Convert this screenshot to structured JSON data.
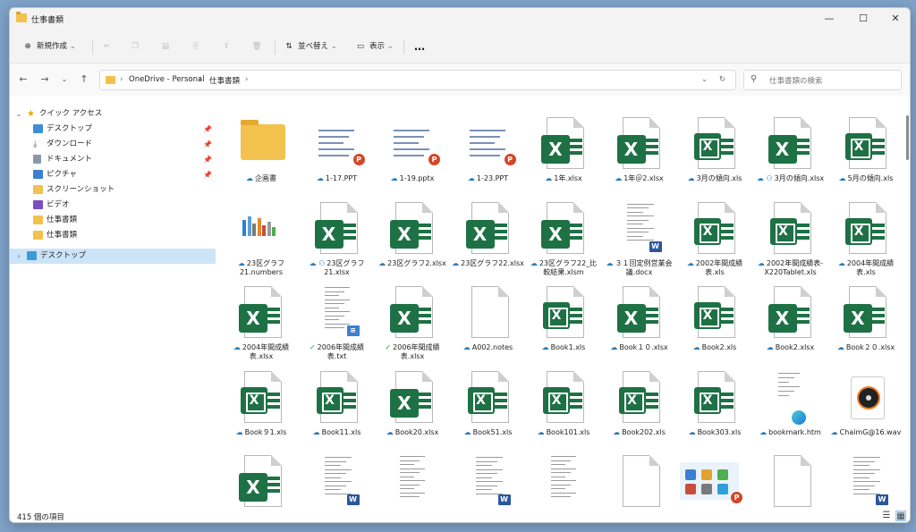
{
  "window": {
    "title": "仕事書類",
    "minimize": "—",
    "maximize": "☐",
    "close": "✕"
  },
  "commandbar": {
    "new_label": "新規作成",
    "sort_label": "並べ替え",
    "view_label": "表示",
    "more": "…"
  },
  "nav": {
    "breadcrumb": [
      "OneDrive - Personal",
      "仕事書類"
    ],
    "search_placeholder": "仕事書類の検索"
  },
  "sidebar": {
    "quick_access": "クイック アクセス",
    "items": [
      {
        "label": "デスクトップ",
        "pinned": true,
        "icon": "desktop-icon"
      },
      {
        "label": "ダウンロード",
        "pinned": true,
        "icon": "download-icon"
      },
      {
        "label": "ドキュメント",
        "pinned": true,
        "icon": "document-icon"
      },
      {
        "label": "ピクチャ",
        "pinned": true,
        "icon": "picture-icon"
      },
      {
        "label": "スクリーンショット",
        "pinned": false,
        "icon": "folder-icon"
      },
      {
        "label": "ビデオ",
        "pinned": false,
        "icon": "video-icon"
      },
      {
        "label": "仕事書類",
        "pinned": false,
        "icon": "folder-icon"
      },
      {
        "label": "仕事書類",
        "pinned": false,
        "icon": "folder-icon"
      }
    ],
    "desktop_root": "デスクトップ"
  },
  "files": [
    {
      "name": "企画書",
      "type": "folder",
      "status": "cloud"
    },
    {
      "name": "1-17.PPT",
      "type": "ppt",
      "status": "cloud"
    },
    {
      "name": "1-19.pptx",
      "type": "ppt",
      "status": "cloud"
    },
    {
      "name": "1-23.PPT",
      "type": "ppt",
      "status": "cloud"
    },
    {
      "name": "1年.xlsx",
      "type": "xlsx",
      "status": "cloud"
    },
    {
      "name": "1年＠2.xlsx",
      "type": "xlsx",
      "status": "cloud"
    },
    {
      "name": "3月の傾向.xls",
      "type": "xls",
      "status": "cloud"
    },
    {
      "name": "3月の傾向.xlsx",
      "type": "xlsx",
      "status": "shared"
    },
    {
      "name": "5月の傾向.xls",
      "type": "xls",
      "status": "cloud"
    },
    {
      "name": "23区グラフ21.numbers",
      "type": "numbers",
      "status": "cloud"
    },
    {
      "name": "23区グラフ21.xlsx",
      "type": "xlsx",
      "status": "shared"
    },
    {
      "name": "23区グラフ2.xlsx",
      "type": "xlsx",
      "status": "cloud"
    },
    {
      "name": "23区グラフ22.xlsx",
      "type": "xlsx",
      "status": "cloud"
    },
    {
      "name": "23区グラフ22_比較結果.xlsm",
      "type": "xlsm",
      "status": "cloud"
    },
    {
      "name": "３１回定例営業会議.docx",
      "type": "docx",
      "status": "cloud"
    },
    {
      "name": "2002年間成績表.xls",
      "type": "xls",
      "status": "cloud"
    },
    {
      "name": "2002年間成績表-X220Tablet.xls",
      "type": "xls",
      "status": "cloud"
    },
    {
      "name": "2004年間成績表.xls",
      "type": "xls",
      "status": "cloud"
    },
    {
      "name": "2004年間成績表.xlsx",
      "type": "xlsx",
      "status": "cloud"
    },
    {
      "name": "2006年間成績表.txt",
      "type": "txt",
      "status": "ok"
    },
    {
      "name": "2006年間成績表.xlsx",
      "type": "xlsx",
      "status": "ok"
    },
    {
      "name": "A002.notes",
      "type": "blank",
      "status": "cloud"
    },
    {
      "name": "Book1.xls",
      "type": "xls",
      "status": "cloud"
    },
    {
      "name": "Book１０.xlsx",
      "type": "xlsx",
      "status": "cloud"
    },
    {
      "name": "Book2.xls",
      "type": "xls",
      "status": "cloud"
    },
    {
      "name": "Book2.xlsx",
      "type": "xlsx",
      "status": "cloud"
    },
    {
      "name": "Book２０.xlsx",
      "type": "xlsx",
      "status": "cloud"
    },
    {
      "name": "Book９1.xls",
      "type": "xls",
      "status": "cloud"
    },
    {
      "name": "Book11.xls",
      "type": "xls",
      "status": "cloud"
    },
    {
      "name": "Book20.xlsx",
      "type": "xlsx",
      "status": "cloud"
    },
    {
      "name": "Book51.xls",
      "type": "xls",
      "status": "cloud"
    },
    {
      "name": "Book101.xls",
      "type": "xls",
      "status": "cloud"
    },
    {
      "name": "Book202.xls",
      "type": "xls",
      "status": "cloud"
    },
    {
      "name": "Book303.xls",
      "type": "xls",
      "status": "cloud"
    },
    {
      "name": "bookmark.htm",
      "type": "htm",
      "status": "cloud"
    },
    {
      "name": "ChaimG@16.wav",
      "type": "wav",
      "status": "cloud"
    },
    {
      "name": "",
      "type": "xlsx",
      "status": ""
    },
    {
      "name": "",
      "type": "docx",
      "status": ""
    },
    {
      "name": "",
      "type": "paper",
      "status": ""
    },
    {
      "name": "",
      "type": "docx",
      "status": ""
    },
    {
      "name": "",
      "type": "paper",
      "status": ""
    },
    {
      "name": "",
      "type": "blank",
      "status": ""
    },
    {
      "name": "",
      "type": "pptimg",
      "status": ""
    },
    {
      "name": "",
      "type": "blank",
      "status": ""
    },
    {
      "name": "",
      "type": "docx",
      "status": ""
    }
  ],
  "status": {
    "item_count": "415 個の項目"
  },
  "colors": {
    "excel_green": "#1e7145",
    "folder_yellow": "#f2c14e",
    "selection_blue": "#cce4f7",
    "cloud_blue": "#2a7ab8",
    "ok_green": "#2f8f3f"
  }
}
